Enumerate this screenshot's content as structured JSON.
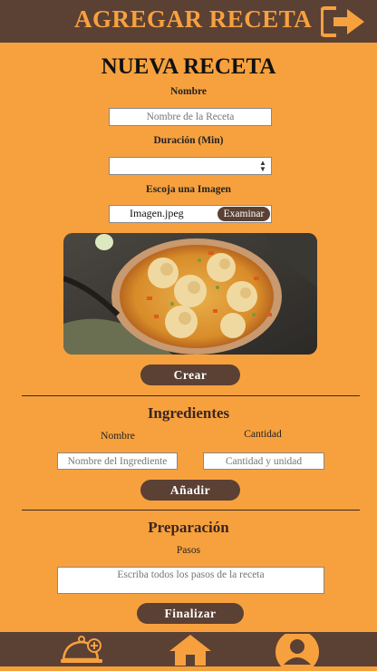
{
  "header": {
    "title": "AGREGAR RECETA",
    "logout_icon": "logout-arrow-icon"
  },
  "form": {
    "heading": "NUEVA RECETA",
    "name_label": "Nombre",
    "name_placeholder": "Nombre de la Receta",
    "duration_label": "Duración (Min)",
    "duration_value": "",
    "image_label": "Escoja una Imagen",
    "image_filename": "Imagen.jpeg",
    "browse_label": "Examinar",
    "create_label": "Crear"
  },
  "ingredients": {
    "heading": "Ingredientes",
    "name_col": "Nombre",
    "qty_col": "Cantidad",
    "name_placeholder": "Nombre del Ingrediente",
    "qty_placeholder": "Cantidad y unidad",
    "add_label": "Añadir"
  },
  "preparation": {
    "heading": "Preparación",
    "steps_label": "Pasos",
    "steps_placeholder": "Escriba todos los pasos de la receta",
    "finish_label": "Finalizar"
  },
  "bottom_nav": {
    "items": [
      "new-recipe-icon",
      "home-icon",
      "profile-icon"
    ]
  },
  "colors": {
    "background": "#F7A13E",
    "brand_brown": "#5B4034"
  }
}
